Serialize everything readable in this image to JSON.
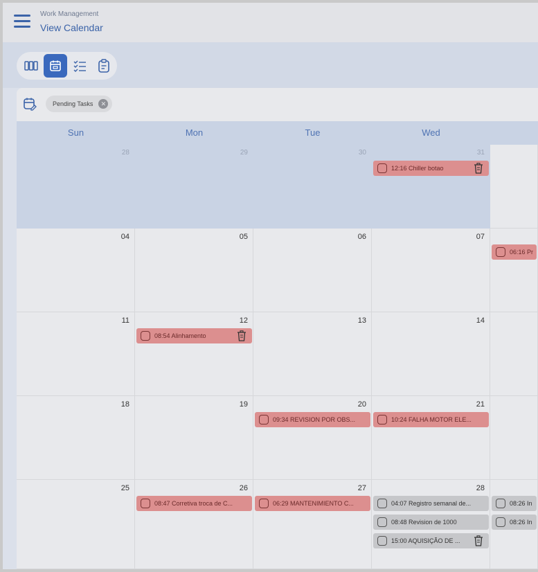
{
  "header": {
    "app_name": "Work Management",
    "title": "View Calendar"
  },
  "toolbar": {
    "views": [
      {
        "name": "columns-view",
        "active": false
      },
      {
        "name": "calendar-view",
        "active": true
      },
      {
        "name": "list-view",
        "active": false
      },
      {
        "name": "clipboard-view",
        "active": false
      }
    ]
  },
  "filter": {
    "chip_label": "Pending Tasks"
  },
  "calendar": {
    "weekdays": [
      "Sun",
      "Mon",
      "Tue",
      "Wed"
    ],
    "weeks": [
      {
        "days": [
          "28",
          "29",
          "30",
          "31",
          ""
        ]
      },
      {
        "days": [
          "04",
          "05",
          "06",
          "07",
          ""
        ]
      },
      {
        "days": [
          "11",
          "12",
          "13",
          "14",
          ""
        ]
      },
      {
        "days": [
          "18",
          "19",
          "20",
          "21",
          ""
        ]
      },
      {
        "days": [
          "25",
          "26",
          "27",
          "28",
          ""
        ]
      }
    ],
    "tasks": [
      {
        "week": 0,
        "day": 3,
        "slot": 0,
        "label": "12:16 Chiller botao",
        "status": "red",
        "trash": true
      },
      {
        "week": 1,
        "day": 4,
        "slot": 0,
        "label": "06:16 Pr",
        "status": "red",
        "trash": false
      },
      {
        "week": 2,
        "day": 1,
        "slot": 0,
        "label": "08:54 Alinhamento",
        "status": "red",
        "trash": true
      },
      {
        "week": 3,
        "day": 2,
        "slot": 0,
        "label": "09:34 REVISION POR OBS...",
        "status": "red",
        "trash": false
      },
      {
        "week": 3,
        "day": 3,
        "slot": 0,
        "label": "10:24 FALHA MOTOR ELE...",
        "status": "red",
        "trash": false
      },
      {
        "week": 4,
        "day": 1,
        "slot": 0,
        "label": "08:47 Corretiva troca de C...",
        "status": "red",
        "trash": false
      },
      {
        "week": 4,
        "day": 2,
        "slot": 0,
        "label": "06:29 MANTENIMIENTO C...",
        "status": "red",
        "trash": false
      },
      {
        "week": 4,
        "day": 3,
        "slot": 0,
        "label": "04:07 Registro semanal de...",
        "status": "grey",
        "trash": false
      },
      {
        "week": 4,
        "day": 3,
        "slot": 1,
        "label": "08:48 Revision de 1000",
        "status": "grey",
        "trash": false
      },
      {
        "week": 4,
        "day": 3,
        "slot": 2,
        "label": "15:00 AQUISIÇÃO DE ...",
        "status": "grey",
        "trash": true
      },
      {
        "week": 4,
        "day": 4,
        "slot": 0,
        "label": "08:26 In",
        "status": "grey",
        "trash": false
      },
      {
        "week": 4,
        "day": 4,
        "slot": 1,
        "label": "08:26 In",
        "status": "grey",
        "trash": false
      }
    ]
  }
}
